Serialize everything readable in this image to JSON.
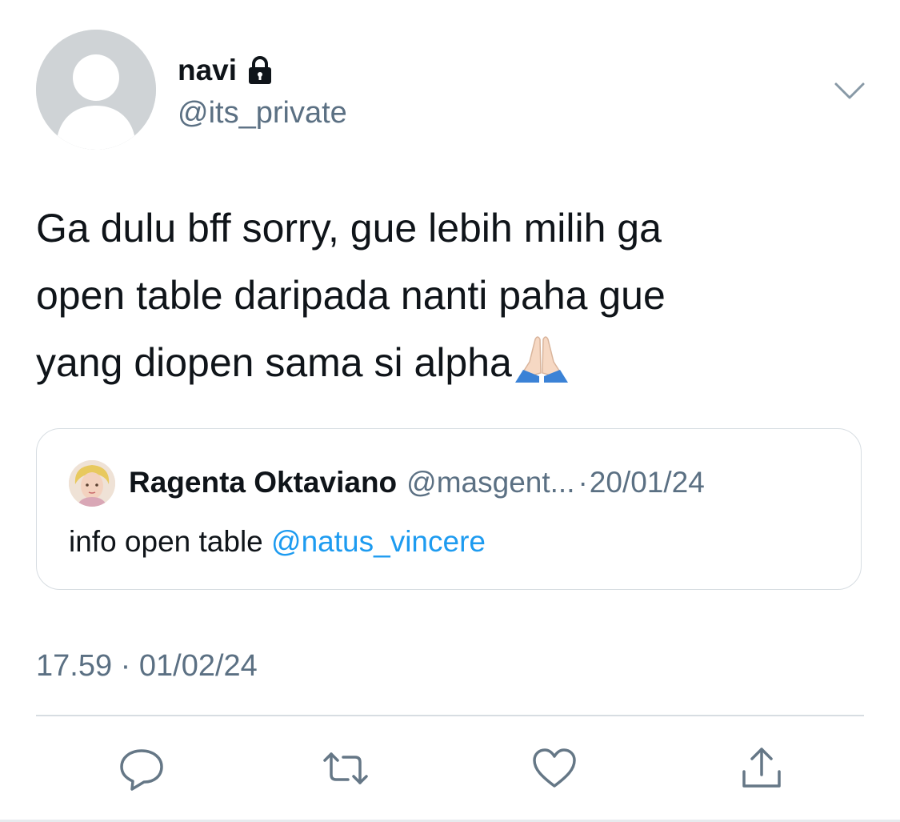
{
  "tweet": {
    "author": {
      "display_name": "navi",
      "handle": "@its_private",
      "protected_icon": "lock-icon",
      "avatar": "default-avatar-icon"
    },
    "text_lines": [
      "Ga dulu bff sorry, gue lebih milih ga",
      "open table daripada nanti paha gue",
      "yang diopen sama si alpha"
    ],
    "text_emoji": "folded-hands-emoji",
    "timestamp": "17.59 · 01/02/24",
    "menu_icon": "chevron-down-icon"
  },
  "quoted_tweet": {
    "author_name": "Ragenta Oktaviano",
    "handle": "@masgent...",
    "separator": "·",
    "date": "20/01/24",
    "text": "info open table ",
    "mention": "@natus_vincere"
  },
  "actions": [
    {
      "name": "reply",
      "icon": "reply-icon"
    },
    {
      "name": "retweet",
      "icon": "retweet-icon"
    },
    {
      "name": "like",
      "icon": "heart-icon"
    },
    {
      "name": "share",
      "icon": "share-icon"
    }
  ],
  "colors": {
    "text": "#0f1419",
    "secondary": "#5b7083",
    "link": "#1d9bf0",
    "border": "#d7dde2"
  }
}
